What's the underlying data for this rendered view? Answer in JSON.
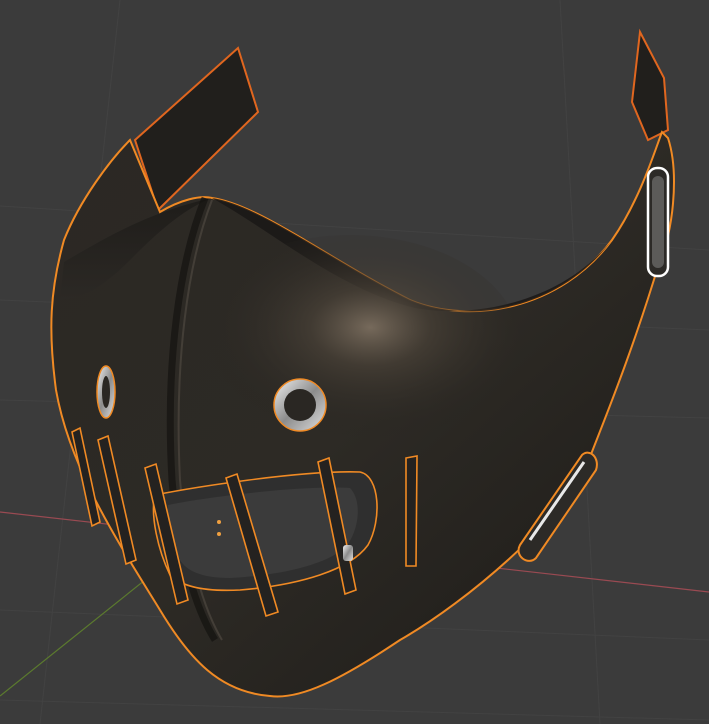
{
  "viewport": {
    "background_color": "#3b3b3b",
    "grid_line_color": "#434343",
    "x_axis_color": "#9a4a52",
    "y_axis_color": "#5b7a2e",
    "selection_outline_color": "#f08a24",
    "active_object_outline_color": "#ffa63a",
    "object_name": "",
    "object_selected": true
  },
  "model": {
    "material_color": "#26231f",
    "highlight_color": "#7a6d5e",
    "metal_color": "#cfcfcf"
  }
}
